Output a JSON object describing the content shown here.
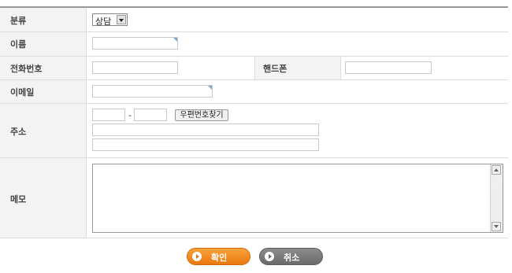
{
  "form": {
    "category": {
      "label": "분류",
      "selected": "상담"
    },
    "name": {
      "label": "이름",
      "value": ""
    },
    "phone": {
      "label": "전화번호",
      "value": ""
    },
    "mobile": {
      "label": "핸드폰",
      "value": ""
    },
    "email": {
      "label": "이메일",
      "value": ""
    },
    "address": {
      "label": "주소",
      "zip_separator": "-",
      "zip_button": "우편번호찾기",
      "zip1": "",
      "zip2": "",
      "line1": "",
      "line2": ""
    },
    "memo": {
      "label": "메모",
      "value": ""
    }
  },
  "buttons": {
    "confirm": "확인",
    "cancel": "취소"
  },
  "colors": {
    "confirm": "#f08c22",
    "cancel": "#7a7a7a",
    "input_corner_accent": "#7fa7c9"
  },
  "icons": {
    "select": "chevron-down-icon",
    "memo_scroll_up": "arrow-up-icon",
    "memo_scroll_down": "arrow-down-icon",
    "button_bullet": "play-circle-icon"
  }
}
